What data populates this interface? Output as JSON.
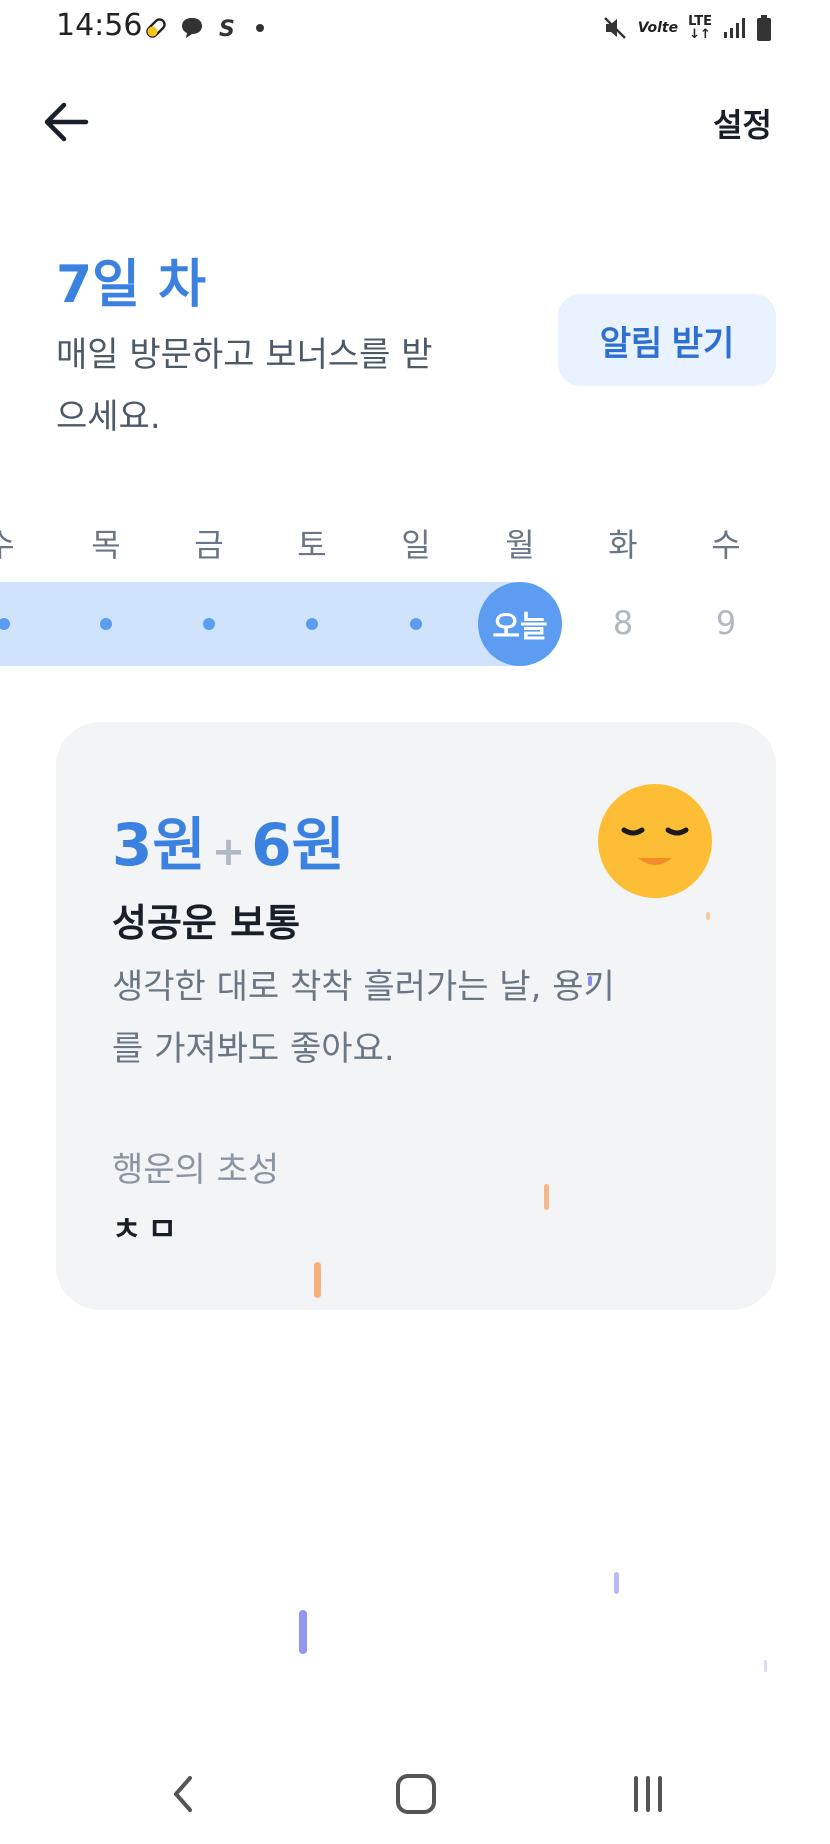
{
  "status_bar": {
    "time": "14:56",
    "network_label": "Volte",
    "lte_label": "LTE"
  },
  "header": {
    "settings_label": "설정"
  },
  "attendance": {
    "day_title": "7일 차",
    "subtitle": "매일 방문하고 보너스를 받으세요.",
    "notify_button": "알림 받기"
  },
  "week": {
    "days": [
      "수",
      "목",
      "금",
      "토",
      "일",
      "월",
      "화",
      "수"
    ],
    "today_label": "오늘",
    "future_dates": [
      "8",
      "9"
    ]
  },
  "fortune": {
    "base_amount": "3원",
    "plus_sign": "+",
    "bonus_amount": "6원",
    "luck_title": "성공운 보통",
    "message": "생각한 대로 착착 흘러가는 날, 용기를 가져봐도 좋아요.",
    "initials_label": "행운의 초성",
    "initials_value": "ㅊㅁ"
  },
  "colors": {
    "accent": "#3b82e0",
    "track": "#cfe3fc",
    "today": "#5c9df2",
    "card": "#f2f4f6",
    "emoji": "#fdbd34"
  }
}
